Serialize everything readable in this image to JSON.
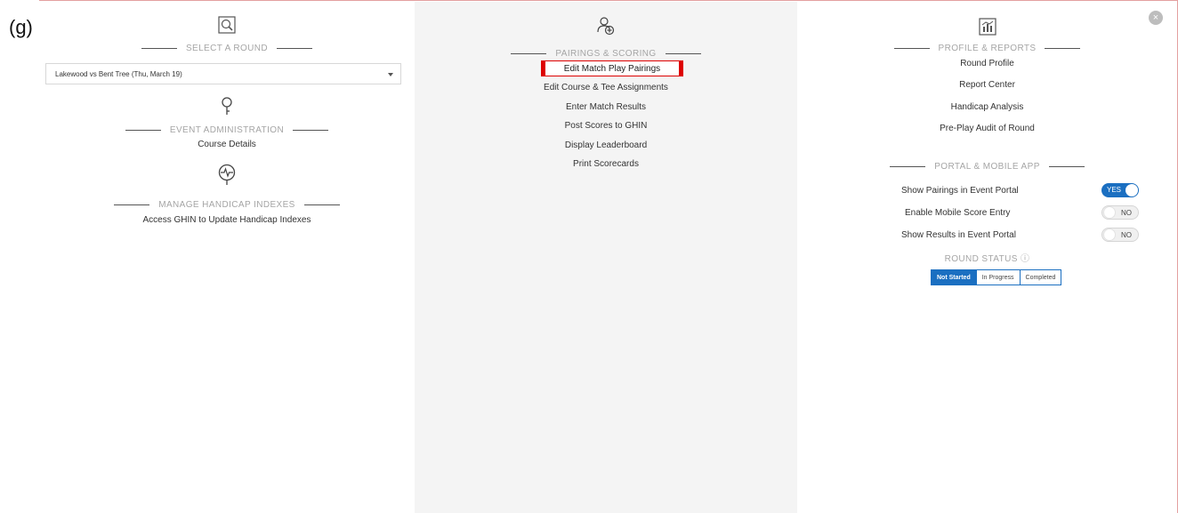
{
  "figure_label": "(g)",
  "left": {
    "select_round_title": "SELECT A ROUND",
    "round_dropdown_value": "Lakewood vs Bent Tree (Thu, March 19)",
    "event_admin_title": "EVENT ADMINISTRATION",
    "event_admin_items": [
      "Course Details"
    ],
    "handicap_title": "MANAGE HANDICAP INDEXES",
    "handicap_items": [
      "Access GHIN to Update Handicap Indexes"
    ]
  },
  "middle": {
    "pairings_title": "PAIRINGS & SCORING",
    "items": [
      "Edit Match Play Pairings",
      "Edit Course & Tee Assignments",
      "Enter Match Results",
      "Post Scores to GHIN",
      "Display Leaderboard",
      "Print Scorecards"
    ]
  },
  "right": {
    "profile_title": "PROFILE & REPORTS",
    "profile_items": [
      "Round Profile",
      "Report Center",
      "Handicap Analysis",
      "Pre-Play Audit of Round"
    ],
    "portal_title": "PORTAL & MOBILE APP",
    "toggles": [
      {
        "label": "Show Pairings in Event Portal",
        "state": "YES"
      },
      {
        "label": "Enable Mobile Score Entry",
        "state": "NO"
      },
      {
        "label": "Show Results in Event Portal",
        "state": "NO"
      }
    ],
    "round_status_label": "ROUND STATUS",
    "round_status_info": "ⓘ",
    "status_options": [
      "Not Started",
      "In Progress",
      "Completed"
    ],
    "status_selected": "Not Started"
  },
  "close_glyph": "×",
  "colors": {
    "accent": "#1b6fc1",
    "highlight": "#dd0000",
    "mid_bg": "#f4f4f4"
  }
}
